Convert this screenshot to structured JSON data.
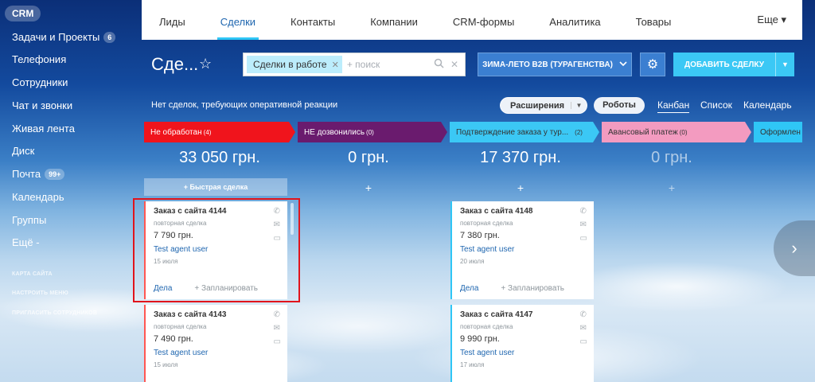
{
  "sidebar": {
    "crm": "CRM",
    "items": [
      {
        "label": "Задачи и Проекты",
        "counter": "6"
      },
      {
        "label": "Телефония"
      },
      {
        "label": "Сотрудники"
      },
      {
        "label": "Чат и звонки"
      },
      {
        "label": "Живая лента"
      },
      {
        "label": "Диск"
      },
      {
        "label": "Почта",
        "counter": "99+"
      },
      {
        "label": "Календарь"
      },
      {
        "label": "Группы"
      },
      {
        "label": "Ещё -"
      }
    ],
    "links": [
      "КАРТА САЙТА",
      "НАСТРОИТЬ МЕНЮ",
      "ПРИГЛАСИТЬ СОТРУДНИКОВ"
    ]
  },
  "topnav": {
    "tabs": [
      "Лиды",
      "Сделки",
      "Контакты",
      "Компании",
      "CRM-формы",
      "Аналитика",
      "Товары"
    ],
    "active": "Сделки",
    "more": "Еще ▾"
  },
  "header": {
    "title": "Сде...",
    "filter_chip": "Сделки в работе",
    "search_placeholder": "+ поиск",
    "pipeline": "ЗИМА-ЛЕТО B2B (ТУРАГЕНСТВА)",
    "add_button": "ДОБАВИТЬ СДЕЛКУ"
  },
  "info": {
    "no_deals": "Нет сделок, требующих оперативной реакции",
    "extensions": "Расширения",
    "robots": "Роботы",
    "views": [
      "Канбан",
      "Список",
      "Календарь"
    ]
  },
  "columns": [
    {
      "name": "Не обработан",
      "count": "(4)",
      "color": "#f0141c",
      "sum": "33 050 грн."
    },
    {
      "name": "НЕ дозвонились",
      "count": "(0)",
      "color": "#6a1b6e",
      "sum": "0 грн."
    },
    {
      "name": "Подтверждение заказа у тур...",
      "count": "(2)",
      "color": "#3bc8f5",
      "sum": "17 370 грн."
    },
    {
      "name": "Авансовый платеж",
      "count": "(0)",
      "color": "#f39bc0",
      "sum": "0 грн."
    },
    {
      "name": "Оформлен",
      "count": "",
      "color": "#2fc6f6",
      "sum": ""
    }
  ],
  "quick_deal": "+ Быстрая сделка",
  "cards": [
    {
      "title": "Заказ с сайта 4144",
      "sub": "повторная сделка",
      "price": "7 790 грн.",
      "user": "Test agent user",
      "date": "15 июля",
      "dela": "Дела",
      "plan": "+ Запланировать"
    },
    {
      "title": "Заказ с сайта 4143",
      "sub": "повторная сделка",
      "price": "7 490 грн.",
      "user": "Test agent user",
      "date": "15 июля"
    },
    {
      "title": "Заказ с сайта 4148",
      "sub": "повторная сделка",
      "price": "7 380 грн.",
      "user": "Test agent user",
      "date": "20 июля",
      "dela": "Дела",
      "plan": "+ Запланировать"
    },
    {
      "title": "Заказ с сайта 4147",
      "sub": "повторная сделка",
      "price": "9 990 грн.",
      "user": "Test agent user",
      "date": "17 июля"
    }
  ]
}
